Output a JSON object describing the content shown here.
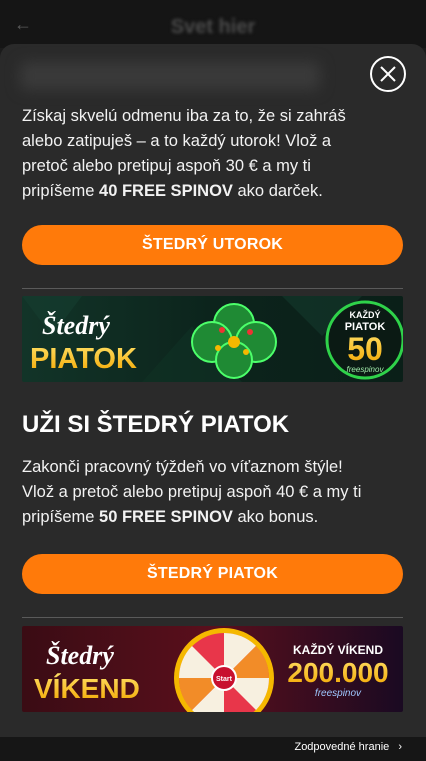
{
  "appbar": {
    "back_icon": "←",
    "title": "Svet hier"
  },
  "modal": {
    "close_icon": "close-icon",
    "tuesday": {
      "line1": "Získaj skvelú odmenu iba za to, že si zahráš",
      "line2": "alebo zatipuješ – a to každý utorok! Vlož a",
      "line3": "pretoč alebo pretipuj aspoň 30 € a my ti",
      "line4_pre": "pripíšeme ",
      "line4_bold": "40 FREE SPINOV",
      "line4_post": " ako darček.",
      "button": "ŠTEDRÝ UTOROK"
    },
    "friday_banner": {
      "word1": "Štedrý",
      "word2": "PIATOK",
      "badge_line1": "KAŽDÝ",
      "badge_line2": "PIATOK",
      "badge_number": "50",
      "badge_sub": "freespinov"
    },
    "friday": {
      "heading": "UŽI SI ŠTEDRÝ PIATOK",
      "line1": "Zakonči pracovný týždeň vo víťaznom štýle!",
      "line2": "Vlož a pretoč alebo pretipuj aspoň 40 € a my ti",
      "line3_pre": "pripíšeme ",
      "line3_bold": "50 FREE SPINOV",
      "line3_post": " ako bonus.",
      "button": "ŠTEDRÝ PIATOK"
    },
    "weekend_banner": {
      "word1": "Štedrý",
      "word2": "VÍKEND",
      "wheel_center": "Start",
      "right_line1": "KAŽDÝ VÍKEND",
      "right_number": "200.000",
      "right_sub": "freespinov"
    }
  },
  "footer": {
    "link": "Zodpovedné hranie",
    "chevron": "›"
  },
  "colors": {
    "accent": "#ff7a0a",
    "background": "#2a2a2a",
    "clover": "#2fd24a",
    "gold": "#f5b800"
  }
}
